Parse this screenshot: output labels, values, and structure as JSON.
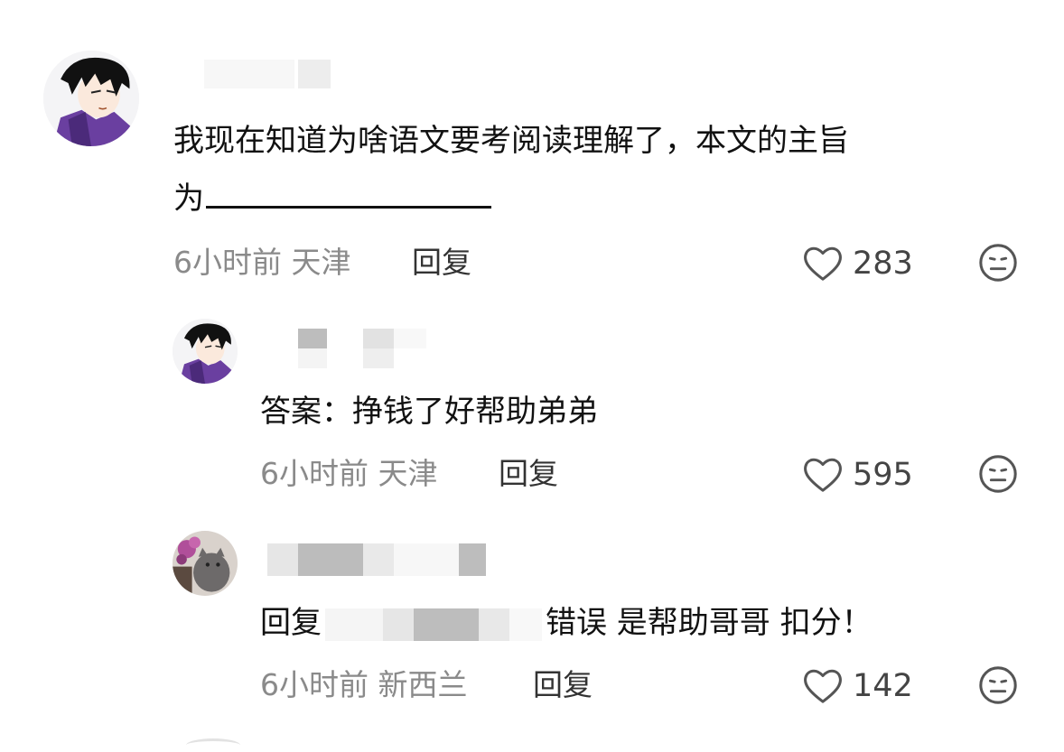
{
  "comments": [
    {
      "text_line1": "我现在知道为啥语文要考阅读理解了，本文的主旨",
      "text_line2": "为",
      "time": "6小时前",
      "location": "天津",
      "reply_label": "回复",
      "likes": "283"
    },
    {
      "text": "答案：挣钱了好帮助弟弟",
      "time": "6小时前",
      "location": "天津",
      "reply_label": "回复",
      "likes": "595"
    },
    {
      "reply_prefix": "回复",
      "text": "错误 是帮助哥哥 扣分！",
      "time": "6小时前",
      "location": "新西兰",
      "reply_label": "回复",
      "likes": "142"
    }
  ],
  "icons": {
    "like": "heart-outline-icon",
    "dislike": "frown-face-icon"
  },
  "colors": {
    "text": "#111111",
    "meta": "#8a8a8a",
    "icon": "#555555"
  }
}
